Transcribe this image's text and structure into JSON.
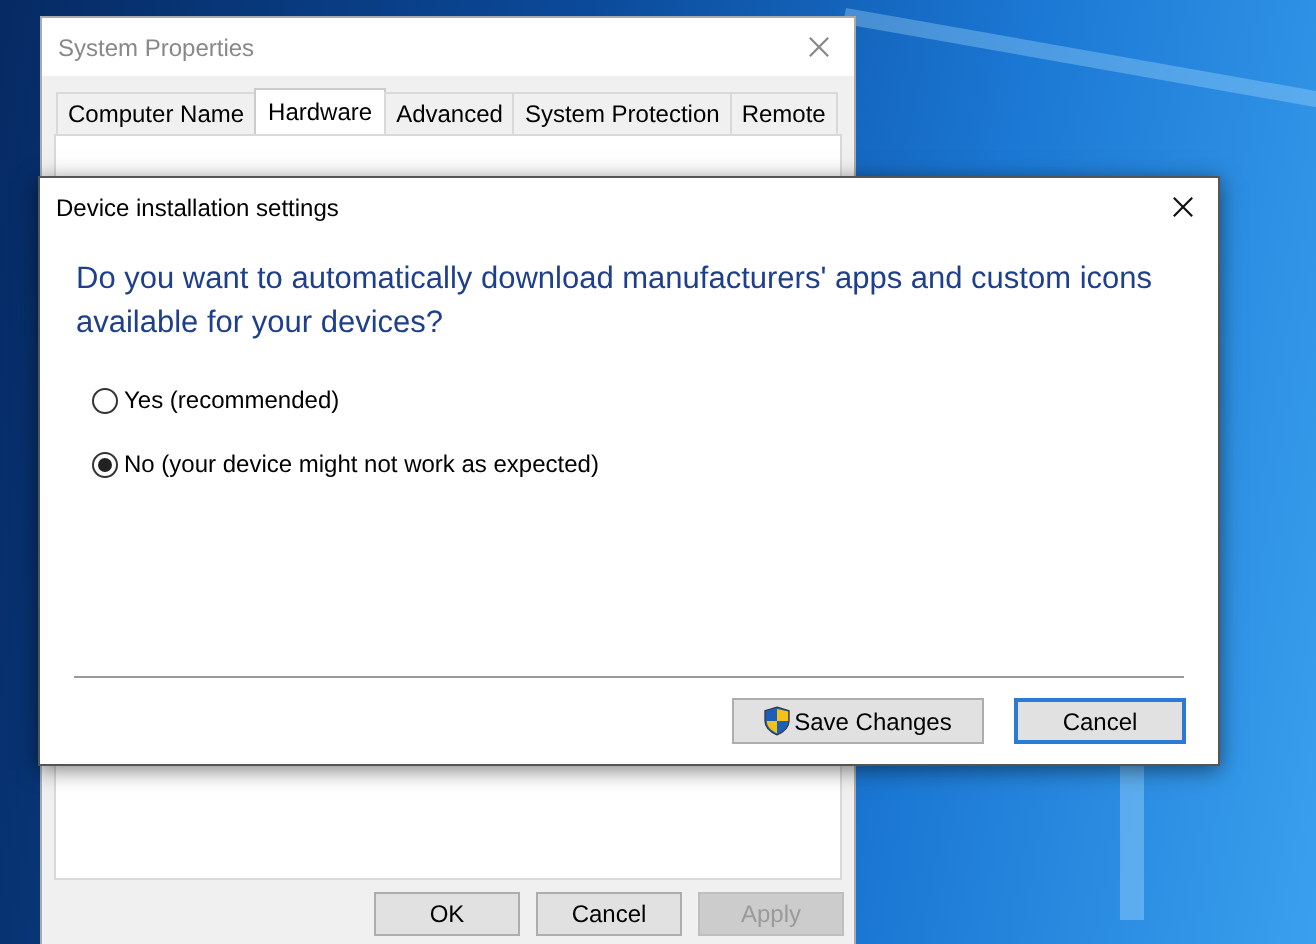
{
  "background_window": {
    "title": "System Properties",
    "tabs": [
      {
        "label": "Computer Name",
        "selected": false
      },
      {
        "label": "Hardware",
        "selected": true
      },
      {
        "label": "Advanced",
        "selected": false
      },
      {
        "label": "System Protection",
        "selected": false
      },
      {
        "label": "Remote",
        "selected": false
      }
    ],
    "buttons": [
      {
        "label": "OK",
        "disabled": false
      },
      {
        "label": "Cancel",
        "disabled": false
      },
      {
        "label": "Apply",
        "disabled": true
      }
    ]
  },
  "dialog": {
    "title": "Device installation settings",
    "question": "Do you want to automatically download manufacturers' apps and custom icons available for your devices?",
    "options": [
      {
        "label": "Yes (recommended)",
        "selected": false
      },
      {
        "label": "No (your device might not work as expected)",
        "selected": true
      }
    ],
    "buttons": [
      {
        "label": "Save Changes",
        "kind": "elevated"
      },
      {
        "label": "Cancel",
        "kind": "default"
      }
    ]
  }
}
